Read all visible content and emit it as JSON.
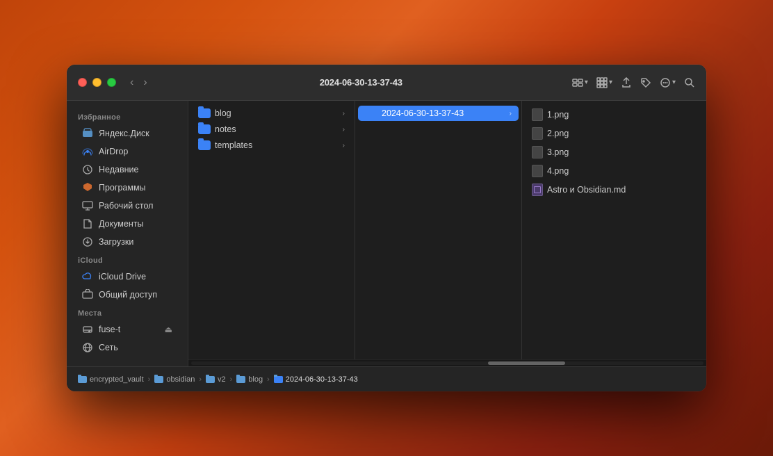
{
  "window": {
    "title": "2024-06-30-13-37-43"
  },
  "sidebar": {
    "favorites_label": "Избранное",
    "icloud_label": "iCloud",
    "places_label": "Места",
    "items": [
      {
        "id": "yandex-disk",
        "label": "Яндекс.Диск",
        "icon": "yandex-disk-icon"
      },
      {
        "id": "airdrop",
        "label": "AirDrop",
        "icon": "airdrop-icon"
      },
      {
        "id": "recents",
        "label": "Недавние",
        "icon": "recents-icon"
      },
      {
        "id": "programs",
        "label": "Программы",
        "icon": "programs-icon"
      },
      {
        "id": "desktop",
        "label": "Рабочий стол",
        "icon": "desktop-icon"
      },
      {
        "id": "documents",
        "label": "Документы",
        "icon": "documents-icon"
      },
      {
        "id": "downloads",
        "label": "Загрузки",
        "icon": "downloads-icon"
      },
      {
        "id": "icloud-drive",
        "label": "iCloud Drive",
        "icon": "icloud-icon"
      },
      {
        "id": "shared",
        "label": "Общий доступ",
        "icon": "shared-icon"
      },
      {
        "id": "fuse-t",
        "label": "fuse-t",
        "icon": "drive-icon"
      },
      {
        "id": "network",
        "label": "Сеть",
        "icon": "network-icon"
      }
    ]
  },
  "columns": {
    "col1_items": [
      {
        "id": "blog",
        "label": "blog",
        "type": "folder",
        "active": false
      },
      {
        "id": "notes",
        "label": "notes",
        "type": "folder",
        "active": false
      },
      {
        "id": "templates",
        "label": "templates",
        "type": "folder",
        "active": false
      }
    ],
    "col2_items": [
      {
        "id": "2024-folder",
        "label": "2024-06-30-13-37-43",
        "type": "folder",
        "active": true
      }
    ],
    "col3_items": [
      {
        "id": "1png",
        "label": "1.png",
        "type": "png"
      },
      {
        "id": "2png",
        "label": "2.png",
        "type": "png"
      },
      {
        "id": "3png",
        "label": "3.png",
        "type": "png"
      },
      {
        "id": "4png",
        "label": "4.png",
        "type": "png"
      },
      {
        "id": "astro-md",
        "label": "Astro и Obsidian.md",
        "type": "md"
      }
    ]
  },
  "breadcrumb": {
    "items": [
      {
        "id": "encrypted-vault",
        "label": "encrypted_vault",
        "icon": "folder"
      },
      {
        "id": "obsidian",
        "label": "obsidian",
        "icon": "folder"
      },
      {
        "id": "v2",
        "label": "v2",
        "icon": "folder"
      },
      {
        "id": "blog-bc",
        "label": "blog",
        "icon": "folder"
      },
      {
        "id": "date-folder",
        "label": "2024-06-30-13-37-43",
        "icon": "folder"
      }
    ]
  },
  "toolbar": {
    "back_label": "‹",
    "forward_label": "›"
  }
}
